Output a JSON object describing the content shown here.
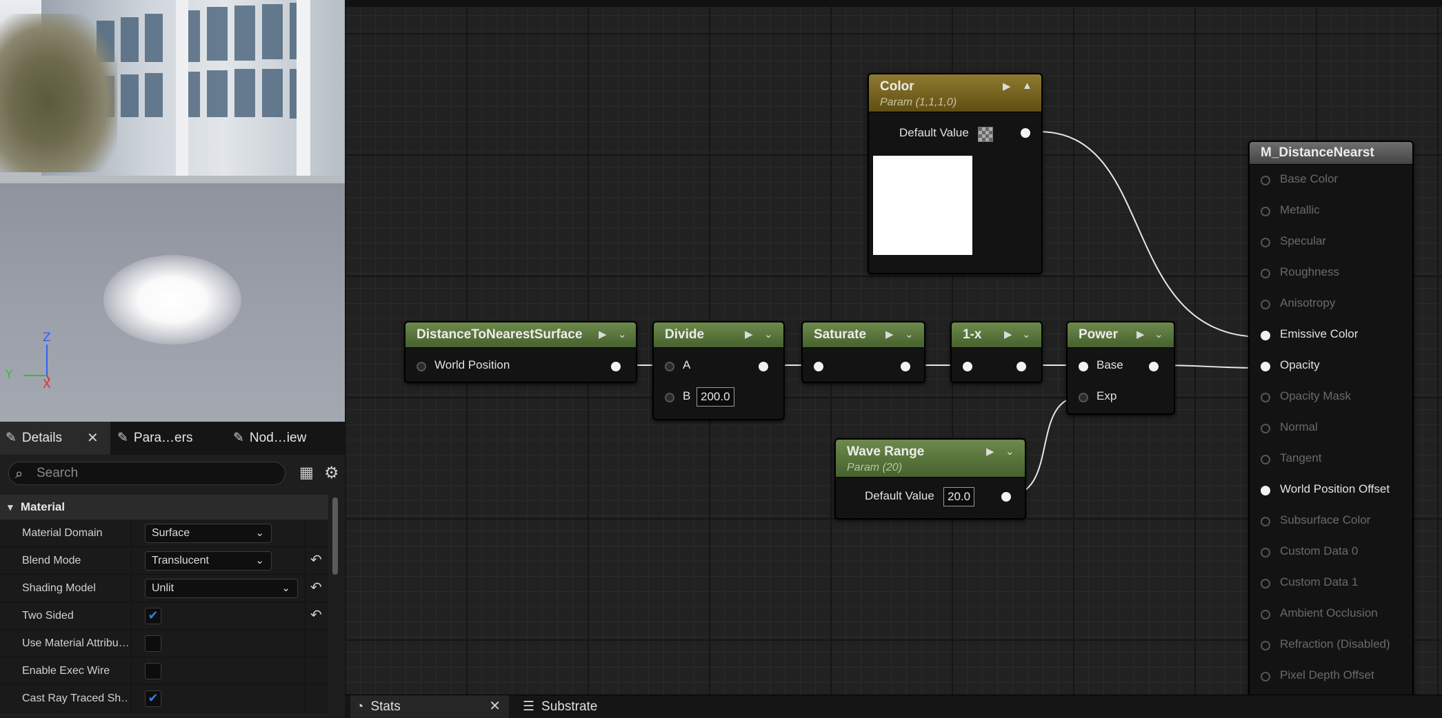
{
  "viewport": {
    "axes": {
      "z": "Z",
      "y": "Y",
      "x": "X"
    }
  },
  "details_panel": {
    "tabs": [
      {
        "label": "Details",
        "active": true
      },
      {
        "label": "Para…ers",
        "active": false
      },
      {
        "label": "Nod…iew",
        "active": false
      }
    ],
    "search_placeholder": "Search",
    "category": "Material",
    "properties": [
      {
        "label": "Material Domain",
        "type": "dropdown",
        "value": "Surface",
        "resettable": false
      },
      {
        "label": "Blend Mode",
        "type": "dropdown",
        "value": "Translucent",
        "resettable": true
      },
      {
        "label": "Shading Model",
        "type": "dropdown",
        "value": "Unlit",
        "resettable": true
      },
      {
        "label": "Two Sided",
        "type": "checkbox",
        "checked": true,
        "resettable": true
      },
      {
        "label": "Use Material Attribu…",
        "type": "checkbox",
        "checked": false,
        "resettable": false
      },
      {
        "label": "Enable Exec Wire",
        "type": "checkbox",
        "checked": false,
        "resettable": false
      },
      {
        "label": "Cast Ray Traced Sh…",
        "type": "checkbox",
        "checked": true,
        "resettable": false
      }
    ]
  },
  "graph": {
    "nodes": {
      "color": {
        "title": "Color",
        "subtitle": "Param (1,1,1,0)",
        "default_label": "Default Value"
      },
      "distance": {
        "title": "DistanceToNearestSurface",
        "input": "World Position"
      },
      "divide": {
        "title": "Divide",
        "input_a": "A",
        "input_b": "B",
        "b_value": "200.0"
      },
      "saturate": {
        "title": "Saturate"
      },
      "one_minus": {
        "title": "1-x"
      },
      "power": {
        "title": "Power",
        "input_base": "Base",
        "input_exp": "Exp"
      },
      "wave_range": {
        "title": "Wave Range",
        "subtitle": "Param (20)",
        "default_label": "Default Value",
        "value": "20.0"
      },
      "material": {
        "title": "M_DistanceNearst",
        "pins": [
          {
            "label": "Base Color",
            "active": false
          },
          {
            "label": "Metallic",
            "active": false
          },
          {
            "label": "Specular",
            "active": false
          },
          {
            "label": "Roughness",
            "active": false
          },
          {
            "label": "Anisotropy",
            "active": false
          },
          {
            "label": "Emissive Color",
            "active": true
          },
          {
            "label": "Opacity",
            "active": true
          },
          {
            "label": "Opacity Mask",
            "active": false
          },
          {
            "label": "Normal",
            "active": false
          },
          {
            "label": "Tangent",
            "active": false
          },
          {
            "label": "World Position Offset",
            "active": true
          },
          {
            "label": "Subsurface Color",
            "active": false
          },
          {
            "label": "Custom Data 0",
            "active": false
          },
          {
            "label": "Custom Data 1",
            "active": false
          },
          {
            "label": "Ambient Occlusion",
            "active": false
          },
          {
            "label": "Refraction (Disabled)",
            "active": false
          },
          {
            "label": "Pixel Depth Offset",
            "active": false
          }
        ]
      }
    }
  },
  "bottom_tabs": [
    {
      "label": "Stats",
      "active": true
    },
    {
      "label": "Substrate",
      "active": false
    }
  ],
  "colors": {
    "node_header_green": "#46612e",
    "node_header_gold": "#5f4e14",
    "check_blue": "#2d7fe0"
  }
}
